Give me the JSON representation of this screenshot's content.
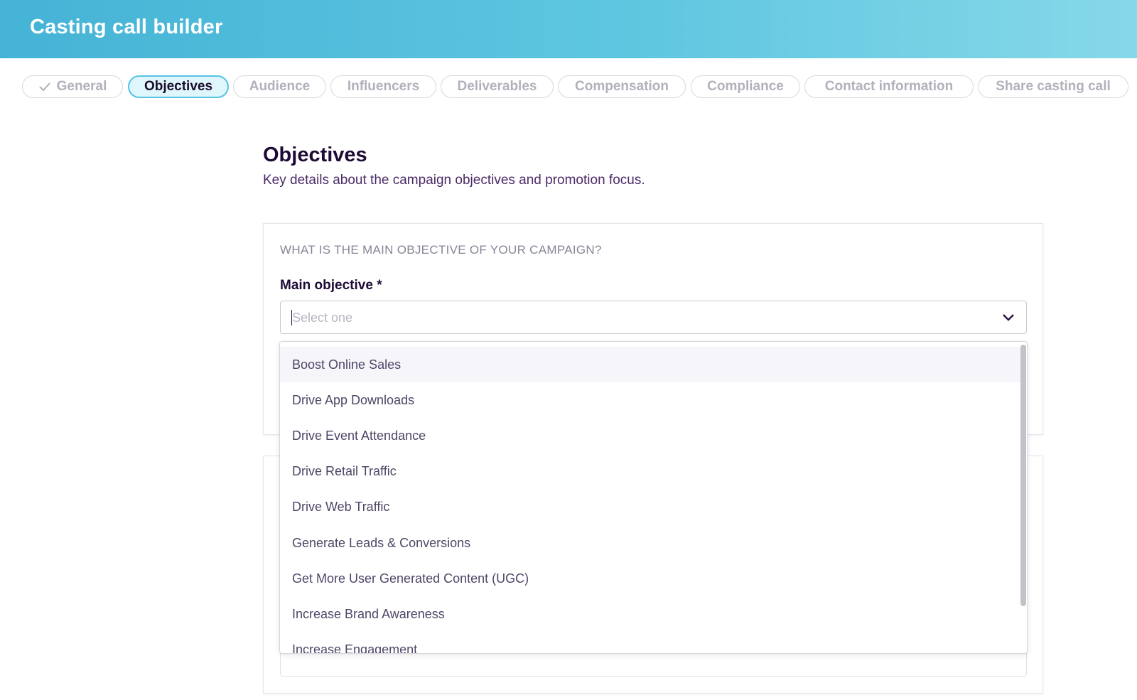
{
  "app": {
    "title": "Casting call builder"
  },
  "steps": [
    {
      "label": "General",
      "state": "done"
    },
    {
      "label": "Objectives",
      "state": "active"
    },
    {
      "label": "Audience",
      "state": "pending"
    },
    {
      "label": "Influencers",
      "state": "pending"
    },
    {
      "label": "Deliverables",
      "state": "pending"
    },
    {
      "label": "Compensation",
      "state": "pending"
    },
    {
      "label": "Compliance",
      "state": "pending"
    },
    {
      "label": "Contact information",
      "state": "pending"
    },
    {
      "label": "Share casting call",
      "state": "pending"
    }
  ],
  "section": {
    "title": "Objectives",
    "subtitle": "Key details about the campaign objectives and promotion focus."
  },
  "card1": {
    "caption": "WHAT IS THE MAIN OBJECTIVE OF YOUR CAMPAIGN?",
    "field_label": "Main objective *",
    "select": {
      "placeholder": "Select one"
    }
  },
  "dropdown": {
    "options": [
      "Boost Online Sales",
      "Drive App Downloads",
      "Drive Event Attendance",
      "Drive Retail Traffic",
      "Drive Web Traffic",
      "Generate Leads & Conversions",
      "Get More User Generated Content (UGC)",
      "Increase Brand Awareness",
      "Increase Engagement"
    ],
    "highlighted_index": 0
  },
  "colors": {
    "header_start": "#45b3d6",
    "header_end": "#86d8e8",
    "active_step_border": "#56c3e6",
    "active_step_bg": "#dff6fd",
    "heading": "#1e0b36"
  },
  "icons": {
    "done_step": "checkmark-icon",
    "select_toggle": "chevron-down-icon"
  }
}
